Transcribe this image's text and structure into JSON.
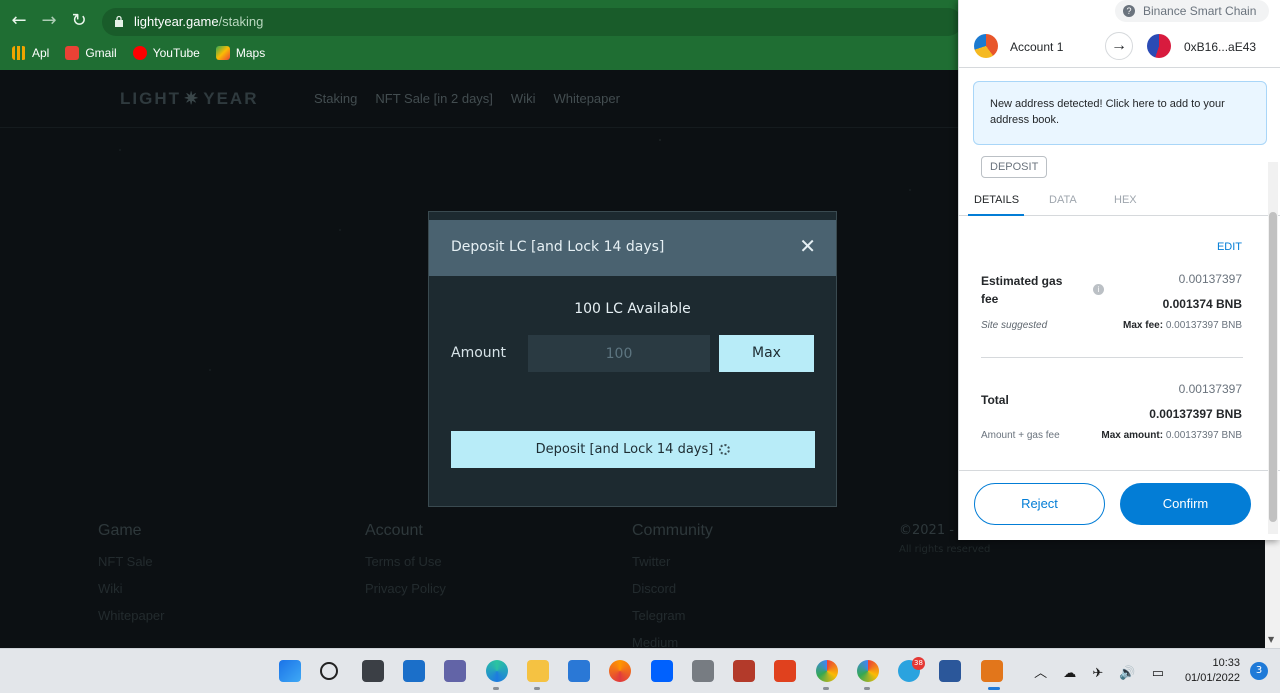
{
  "browser": {
    "url_host": "lightyear.game",
    "url_path": "/staking",
    "bookmarks": [
      {
        "label": "Apl",
        "color": "#f0a500"
      },
      {
        "label": "Gmail",
        "color": "#e94235"
      },
      {
        "label": "YouTube",
        "color": "#ff0000"
      },
      {
        "label": "Maps",
        "color": "#34a853"
      }
    ]
  },
  "site": {
    "logo_left": "LIGHT",
    "logo_star": "✷",
    "logo_right": "YEAR",
    "nav": [
      "Staking",
      "NFT Sale [in 2 days]",
      "Wiki",
      "Whitepaper"
    ],
    "footer": {
      "game": {
        "title": "Game",
        "links": [
          "NFT Sale",
          "Wiki",
          "Whitepaper"
        ]
      },
      "account": {
        "title": "Account",
        "links": [
          "Terms of Use",
          "Privacy Policy"
        ]
      },
      "community": {
        "title": "Community",
        "links": [
          "Twitter",
          "Discord",
          "Telegram",
          "Medium"
        ]
      },
      "copyright": "©2021 -",
      "rights": "All rights reserved"
    }
  },
  "modal": {
    "title": "Deposit LC [and Lock 14 days]",
    "close": "✕",
    "available": "100 LC Available",
    "amount_label": "Amount",
    "amount_value": "100",
    "max_label": "Max",
    "deposit_label": "Deposit [and Lock 14 days]"
  },
  "metamask": {
    "network": "Binance Smart Chain",
    "account_from": "Account 1",
    "account_to": "0xB16...aE43",
    "notice": "New address detected! Click here to add to your address book.",
    "method_tag": "DEPOSIT",
    "tabs": [
      "DETAILS",
      "DATA",
      "HEX"
    ],
    "edit": "EDIT",
    "gas_label_1": "Estimated gas",
    "gas_label_2": "fee",
    "gas_fiat": "0.00137397",
    "gas_value": "0.001374 BNB",
    "site_suggested": "Site suggested",
    "max_fee_label": "Max fee:",
    "max_fee_value": "0.00137397 BNB",
    "total_label": "Total",
    "total_fiat": "0.00137397",
    "total_value": "0.00137397 BNB",
    "amount_gas": "Amount + gas fee",
    "max_amount_label": "Max amount:",
    "max_amount_value": "0.00137397 BNB",
    "reject": "Reject",
    "confirm": "Confirm"
  },
  "taskbar": {
    "time": "10:33",
    "date": "01/01/2022",
    "notifications": "3",
    "telegram_badge": "38",
    "tray_icons": "︿ ☁ ✈ 🔊 ▭"
  }
}
